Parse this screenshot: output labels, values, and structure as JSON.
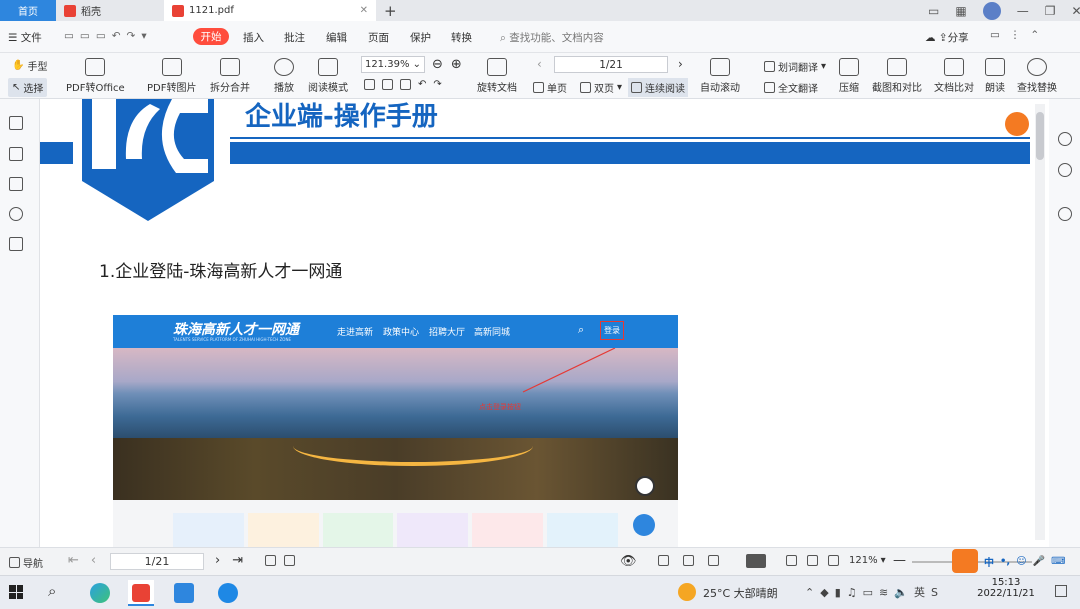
{
  "tabs": [
    {
      "label": "首页"
    },
    {
      "label": "稻壳"
    },
    {
      "label": "1121.pdf"
    }
  ],
  "menu": {
    "file": "文件",
    "start": "开始",
    "items": [
      "插入",
      "批注",
      "编辑",
      "页面",
      "保护",
      "转换"
    ],
    "search_placeholder": "查找功能、文档内容",
    "share": "分享"
  },
  "toolbar": {
    "hand": "手型",
    "select": "选择",
    "pdf_to_office": "PDF转Office",
    "pdf_to_image": "PDF转图片",
    "split_merge": "拆分合并",
    "play": "播放",
    "read_mode": "阅读模式",
    "zoom": "121.39%",
    "rotate": "旋转文档",
    "page_display": "1/21",
    "single_page": "单页",
    "double_page": "双页",
    "continuous": "连续阅读",
    "auto_scroll": "自动滚动",
    "word_translate": "划词翻译",
    "full_translate": "全文翻译",
    "compress": "压缩",
    "screenshot_compare": "截图和对比",
    "doc_compare": "文档比对",
    "read_aloud": "朗读",
    "find_replace": "查找替换"
  },
  "document": {
    "header_title": "企业端-操作手册",
    "section_heading": "1.企业登陆-珠海高新人才一网通",
    "site": {
      "name": "珠海高新人才一网通",
      "subtitle": "TALENTS SERVICE PLATFORM OF ZHUHAI HIGH-TECH ZONE",
      "nav": [
        "走进高新",
        "政策中心",
        "招聘大厅",
        "高新同城"
      ],
      "login": "登录",
      "annotation": "点击登录按钮"
    }
  },
  "status": {
    "nav_label": "导航",
    "page": "1/21",
    "zoom": "121%"
  },
  "taskbar": {
    "weather": "25°C  大部晴朗",
    "ime": "中",
    "time": "15:13",
    "date": "2022/11/21"
  },
  "colors": {
    "accent": "#2e86de",
    "start_button": "#ff4d3d",
    "doc_blue": "#1565c0"
  }
}
